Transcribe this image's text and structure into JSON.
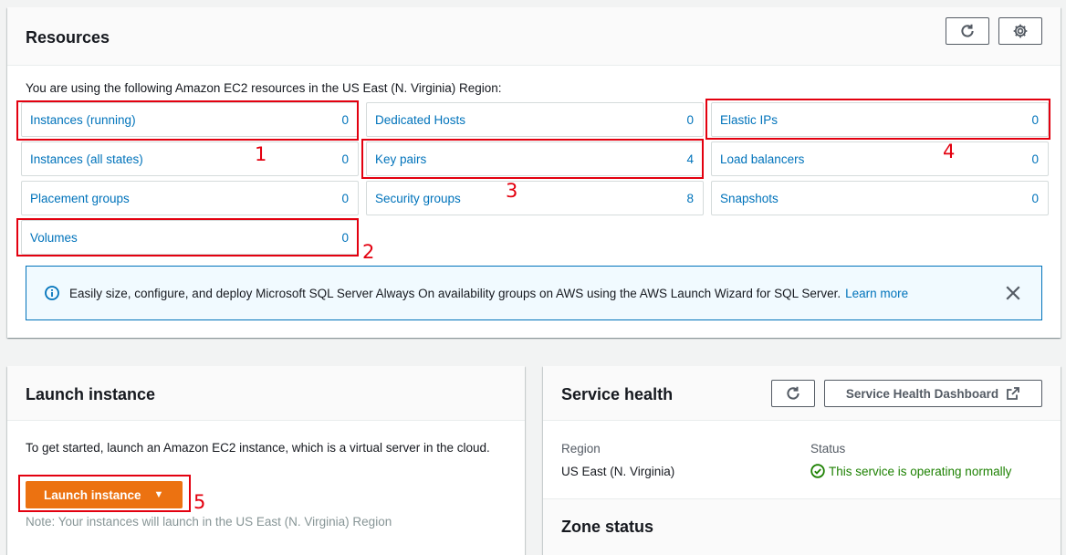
{
  "resources": {
    "title": "Resources",
    "intro": "You are using the following Amazon EC2 resources in the US East (N. Virginia) Region:",
    "refresh_icon": "refresh-icon",
    "settings_icon": "gear-icon",
    "items": [
      {
        "label": "Instances (running)",
        "count": "0"
      },
      {
        "label": "Dedicated Hosts",
        "count": "0"
      },
      {
        "label": "Elastic IPs",
        "count": "0"
      },
      {
        "label": "Instances (all states)",
        "count": "0"
      },
      {
        "label": "Key pairs",
        "count": "4"
      },
      {
        "label": "Load balancers",
        "count": "0"
      },
      {
        "label": "Placement groups",
        "count": "0"
      },
      {
        "label": "Security groups",
        "count": "8"
      },
      {
        "label": "Snapshots",
        "count": "0"
      },
      {
        "label": "Volumes",
        "count": "0"
      }
    ],
    "info_banner": {
      "message": "Easily size, configure, and deploy Microsoft SQL Server Always On availability groups on AWS using the AWS Launch Wizard for SQL Server.",
      "link": "Learn more",
      "icon": "info-icon",
      "close_icon": "close-icon"
    }
  },
  "launch": {
    "title": "Launch instance",
    "description": "To get started, launch an Amazon EC2 instance, which is a virtual server in the cloud.",
    "button_label": "Launch instance",
    "note": "Note: Your instances will launch in the US East (N. Virginia) Region"
  },
  "service_health": {
    "title": "Service health",
    "dashboard_button": "Service Health Dashboard",
    "region_label": "Region",
    "region_value": "US East (N. Virginia)",
    "status_label": "Status",
    "status_value": "This service is operating normally",
    "zone_title": "Zone status"
  },
  "annotations": [
    "1",
    "2",
    "3",
    "4",
    "5"
  ],
  "colors": {
    "link": "#0073bb",
    "primary_button": "#ec7211",
    "annotation": "#e3000f",
    "status_ok": "#1d8102"
  }
}
